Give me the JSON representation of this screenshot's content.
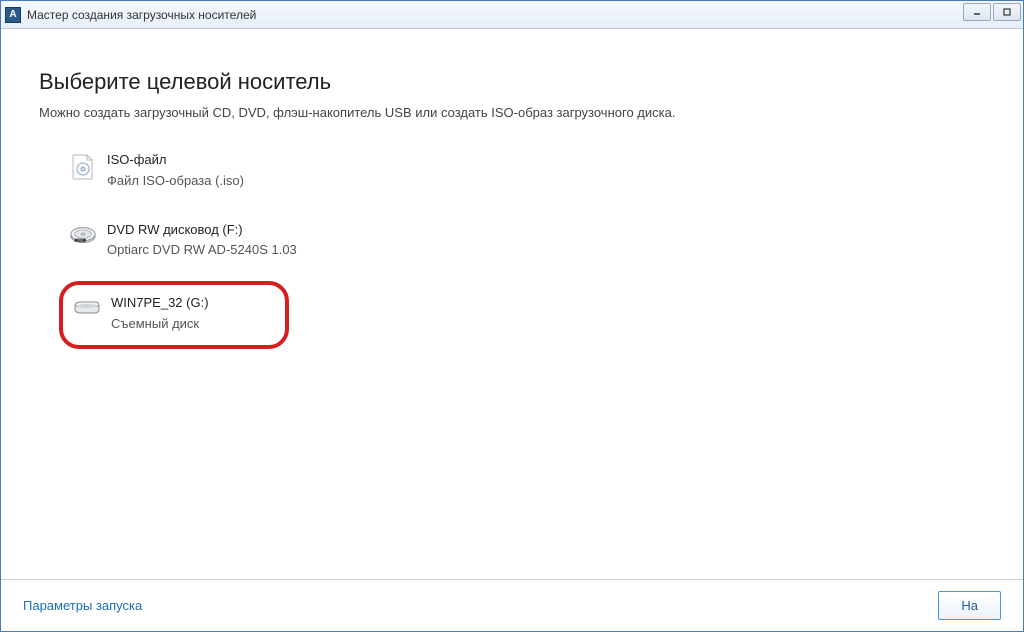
{
  "window": {
    "title": "Мастер создания загрузочных носителей",
    "icon_letter": "A"
  },
  "content": {
    "heading": "Выберите целевой носитель",
    "subheading": "Можно создать загрузочный CD, DVD, флэш-накопитель USB или создать ISO-образ загрузочного диска."
  },
  "media": [
    {
      "title": "ISO-файл",
      "subtitle": "Файл ISO-образа (.iso)",
      "icon": "iso-file-icon",
      "highlighted": false
    },
    {
      "title": "DVD RW дисковод (F:)",
      "subtitle": "Optiarc DVD RW AD-5240S 1.03",
      "icon": "dvd-drive-icon",
      "highlighted": false
    },
    {
      "title": "WIN7PE_32 (G:)",
      "subtitle": "Съемный диск",
      "icon": "removable-disk-icon",
      "highlighted": true
    }
  ],
  "footer": {
    "link": "Параметры запуска",
    "next_button": "На"
  }
}
